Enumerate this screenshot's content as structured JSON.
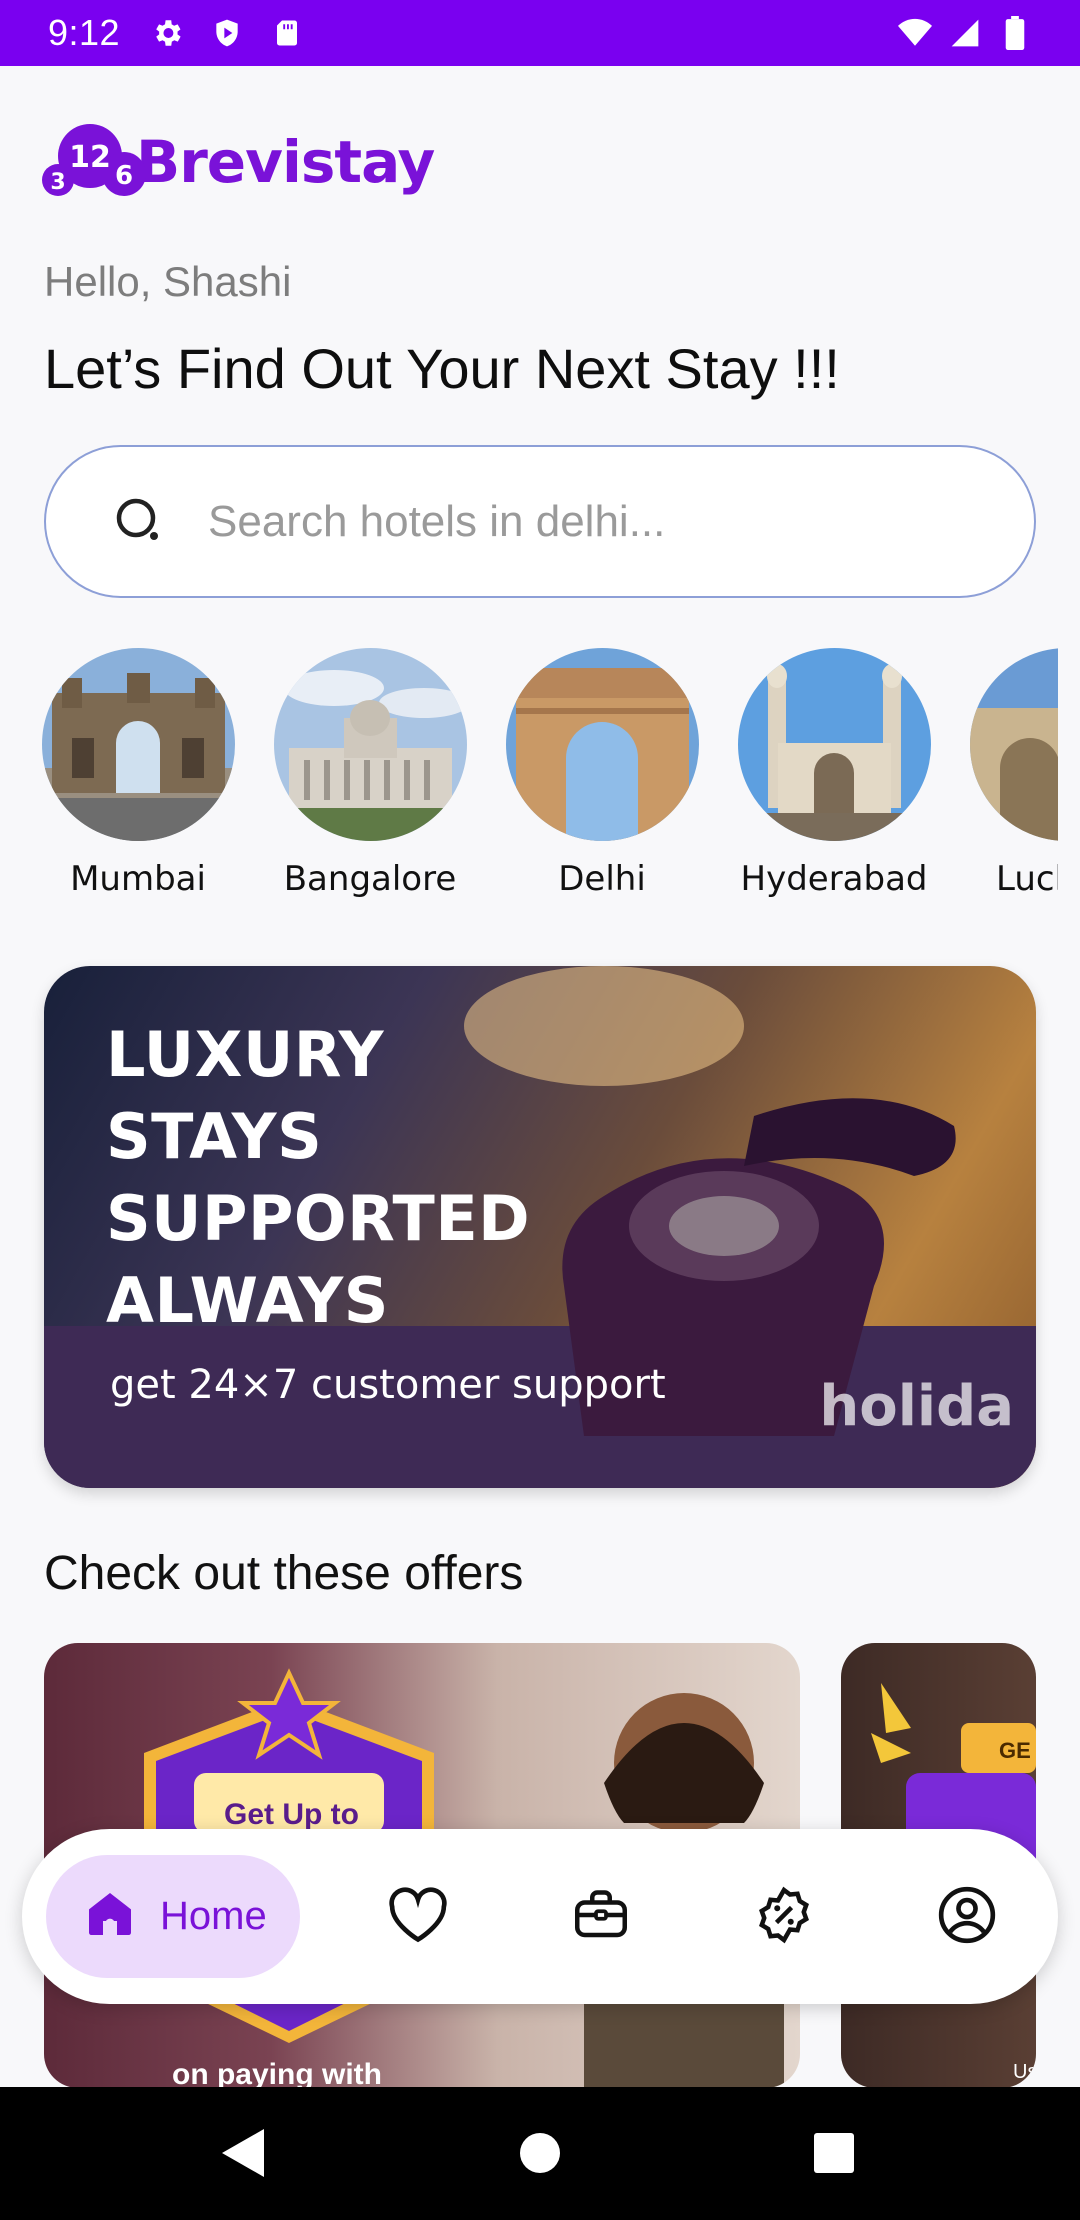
{
  "status_bar": {
    "time": "9:12",
    "left_icons": [
      "gear-icon",
      "shield-play-icon",
      "sd-card-icon"
    ],
    "right_icons": [
      "wifi-icon",
      "signal-icon",
      "battery-icon"
    ],
    "color": "#7a00f0"
  },
  "app": {
    "brand_name": "Brevistay",
    "brand_color": "#7a12d8",
    "logo_digits": [
      "3",
      "12",
      "6"
    ]
  },
  "greeting": "Hello, Shashi",
  "headline": "Let’s Find Out Your Next Stay !!!",
  "search": {
    "placeholder": "Search hotels in delhi...",
    "value": ""
  },
  "cities": [
    {
      "name": "Mumbai"
    },
    {
      "name": "Bangalore"
    },
    {
      "name": "Delhi"
    },
    {
      "name": "Hyderabad"
    },
    {
      "name": "Luck"
    }
  ],
  "banner": {
    "lines": [
      "LUXURY",
      "STAYS",
      "SUPPORTED",
      "ALWAYS"
    ],
    "subtitle": "get 24×7 customer support",
    "brand": "holida"
  },
  "offers": {
    "title": "Check out these offers",
    "cards": [
      {
        "badge_text": "Get Up to",
        "subtitle": "on paying with"
      },
      {
        "badge_text": "GE",
        "fine_print": "Us"
      }
    ]
  },
  "bottom_nav": {
    "items": [
      {
        "label": "Home",
        "icon": "home-icon",
        "active": true
      },
      {
        "label": "",
        "icon": "heart-icon"
      },
      {
        "label": "",
        "icon": "briefcase-icon"
      },
      {
        "label": "",
        "icon": "discount-badge-icon"
      },
      {
        "label": "",
        "icon": "profile-icon"
      }
    ],
    "active_color": "#7a12d8",
    "active_bg": "#ecdafc"
  },
  "system_nav": [
    "back-icon",
    "home-circle-icon",
    "recents-icon"
  ]
}
